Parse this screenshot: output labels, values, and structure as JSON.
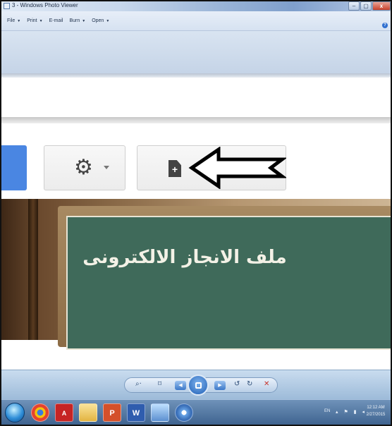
{
  "window": {
    "title": "3 - Windows Photo Viewer",
    "min_label": "–",
    "max_label": "▢",
    "close_label": "x"
  },
  "menu": {
    "items": [
      {
        "label": "File"
      },
      {
        "label": "Print"
      },
      {
        "label": "E-mail"
      },
      {
        "label": "Burn"
      },
      {
        "label": "Open"
      }
    ],
    "help": "?"
  },
  "photo": {
    "board_text": "ملف الانجاز الالكترونى"
  },
  "viewer_toolbar": {
    "zoom": "⌕·",
    "fit": "⌑",
    "prev": "◀",
    "next": "▶",
    "rotate_ccw": "↺",
    "rotate_cw": "↻",
    "delete": "✕"
  },
  "taskbar": {
    "pdf_label": "A",
    "ppt_label": "P",
    "word_label": "W",
    "language": "EN",
    "time": "12:12 AM",
    "date": "2/27/2015"
  },
  "colors": {
    "board_green": "#3f6a5a",
    "accent_blue": "#4a86e2"
  }
}
